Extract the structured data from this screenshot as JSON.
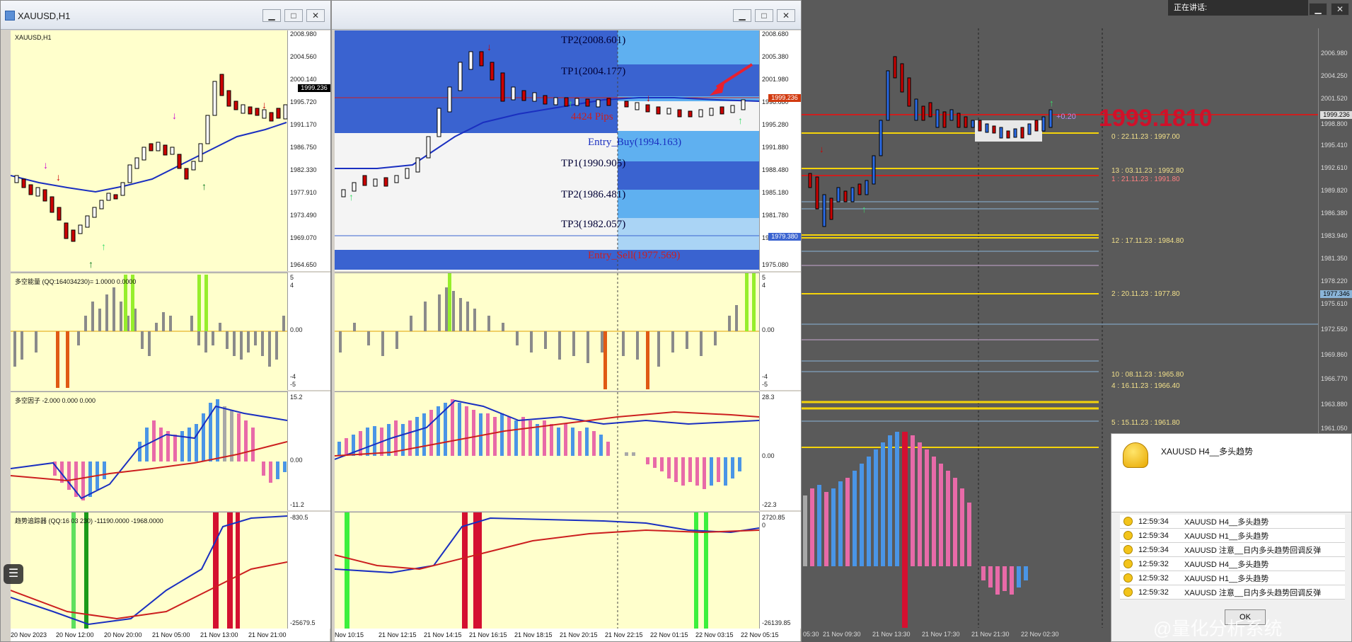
{
  "left_window": {
    "title": "XAUUSD,H1",
    "chart_label": "XAUUSD,H1",
    "price_scale": [
      "2008.980",
      "2004.560",
      "2000.140",
      "1995.720",
      "1991.170",
      "1986.750",
      "1982.330",
      "1977.910",
      "1973.490",
      "1969.070",
      "1964.650"
    ],
    "current_price": "1999.236",
    "ind1_label": "多空能量 (QQ:164034230)= 1.0000 0.0000",
    "ind1_scale": [
      "5",
      "4",
      "0.00",
      "-4",
      "-5"
    ],
    "ind2_label": "多空因子 -2.000 0.000 0.000",
    "ind2_scale": [
      "15.2",
      "0.00",
      "-11.2"
    ],
    "ind3_label": "趋势追踪器 (QQ:16 03 230) -11190.0000 -1968.0000",
    "ind3_scale": [
      "-830.5",
      "-25679.5"
    ],
    "time_labels": [
      "20 Nov 2023",
      "20 Nov 12:00",
      "20 Nov 20:00",
      "21 Nov 05:00",
      "21 Nov 13:00",
      "21 Nov 21:00"
    ]
  },
  "center_window": {
    "price_scale": [
      "2008.680",
      "2005.380",
      "2001.980",
      "1998.680",
      "1995.280",
      "1991.880",
      "1988.480",
      "1985.180",
      "1981.780",
      "1978.380",
      "1975.080"
    ],
    "current_price": "1999.236",
    "second_price": "1979.380",
    "levels": [
      "TP2(2008.601)",
      "TP1(2004.177)",
      "Entry_Buy(1994.163)",
      "TP1(1990.905)",
      "TP2(1986.481)",
      "TP3(1982.057)",
      "Entry_Sell(1977.569)"
    ],
    "pips": "4424 Pips",
    "ind1_scale": [
      "5",
      "4",
      "0.00",
      "-4",
      "-5"
    ],
    "ind2_scale": [
      "28.3",
      "0.00",
      "-22.3"
    ],
    "ind3_scale": [
      "2720.85",
      "0",
      "-26139.85"
    ],
    "time_labels": [
      "Nov 10:15",
      "21 Nov 12:15",
      "21 Nov 14:15",
      "21 Nov 16:15",
      "21 Nov 18:15",
      "21 Nov 20:15",
      "21 Nov 22:15",
      "22 Nov 01:15",
      "22 Nov 03:15",
      "22 Nov 05:15"
    ]
  },
  "right_window": {
    "top_tag": "正在讲话:",
    "price_scale": [
      "2006.980",
      "2004.250",
      "2001.520",
      "1998.800",
      "1995.410",
      "1992.610",
      "1989.820",
      "1986.380",
      "1983.940",
      "1981.350",
      "1978.220",
      "1975.610",
      "1972.550",
      "1969.860",
      "1966.770",
      "1963.880",
      "1961.050"
    ],
    "current_price": "1999.236",
    "marker_price": "1977.346",
    "big_price": "1999.1810",
    "level_labels": [
      "0 : 22.11.23 : 1997.00",
      "13 : 03.11.23 : 1992.80",
      "1 : 21.11.23 : 1991.80",
      "12 : 17.11.23 : 1984.80",
      "2 : 20.11.23 : 1977.80",
      "10 : 08.11.23 : 1965.80",
      "4 : 16.11.23 : 1966.40",
      "5 : 15.11.23 : 1961.80"
    ],
    "small_tag": "+0.20",
    "time_labels": [
      "05:30",
      "21 Nov 09:30",
      "21 Nov 13:30",
      "21 Nov 17:30",
      "21 Nov 21:30",
      "22 Nov 02:30"
    ]
  },
  "notification": {
    "header": "XAUUSD  H4__多头趋势",
    "rows": [
      {
        "time": "12:59:34",
        "text": "XAUUSD  H4__多头趋势"
      },
      {
        "time": "12:59:34",
        "text": "XAUUSD  H1__多头趋势"
      },
      {
        "time": "12:59:34",
        "text": "XAUUSD  注意__日内多头趋势回调反弹"
      },
      {
        "time": "12:59:32",
        "text": "XAUUSD  H4__多头趋势"
      },
      {
        "time": "12:59:32",
        "text": "XAUUSD  H1__多头趋势"
      },
      {
        "time": "12:59:32",
        "text": "XAUUSD  注意__日内多头趋势回调反弹"
      }
    ],
    "ok": "OK"
  },
  "watermark": "@量化分析系统",
  "colors": {
    "chart_bg": "#ffffcc",
    "dark_bg": "#5a5a5a",
    "buy_zone": "#3a63d0",
    "light_blue": "#5fb0f0",
    "red_line": "#cc1f1f",
    "gold": "#f5d40a"
  }
}
